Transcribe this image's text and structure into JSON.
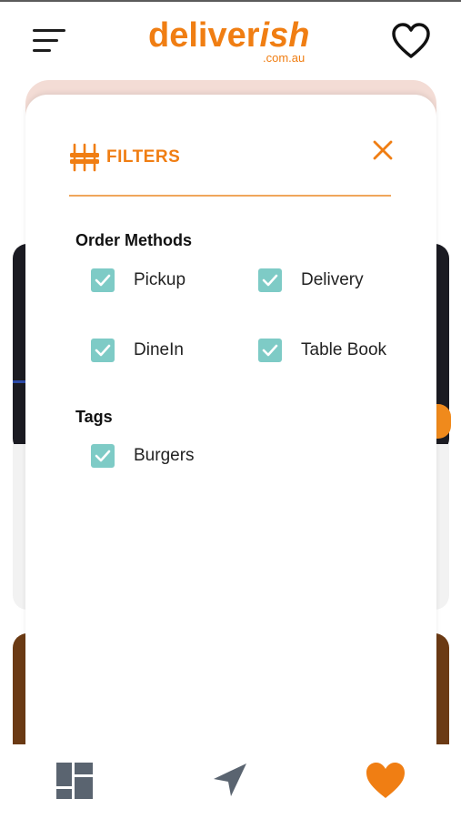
{
  "header": {
    "logo_main": "deliver",
    "logo_accent": "ish",
    "logo_domain": ".com.au"
  },
  "filters": {
    "title": "FILTERS",
    "order_methods": {
      "heading": "Order Methods",
      "options": [
        {
          "label": "Pickup",
          "checked": true
        },
        {
          "label": "Delivery",
          "checked": true
        },
        {
          "label": "DineIn",
          "checked": true
        },
        {
          "label": "Table Book",
          "checked": true
        }
      ]
    },
    "tags": {
      "heading": "Tags",
      "options": [
        {
          "label": "Burgers",
          "checked": true
        }
      ]
    }
  },
  "icons": {
    "menu": "menu-icon",
    "favorites": "heart-outline-icon",
    "filters": "sliders-icon",
    "close": "close-icon",
    "checkbox": "check-icon",
    "nav_browse": "grid-icon",
    "nav_location": "navigation-arrow-icon",
    "nav_favorites": "heart-filled-icon"
  },
  "colors": {
    "brand": "#f07e13",
    "checkbox": "#7ecbc6",
    "nav_inactive": "#5a6470"
  }
}
